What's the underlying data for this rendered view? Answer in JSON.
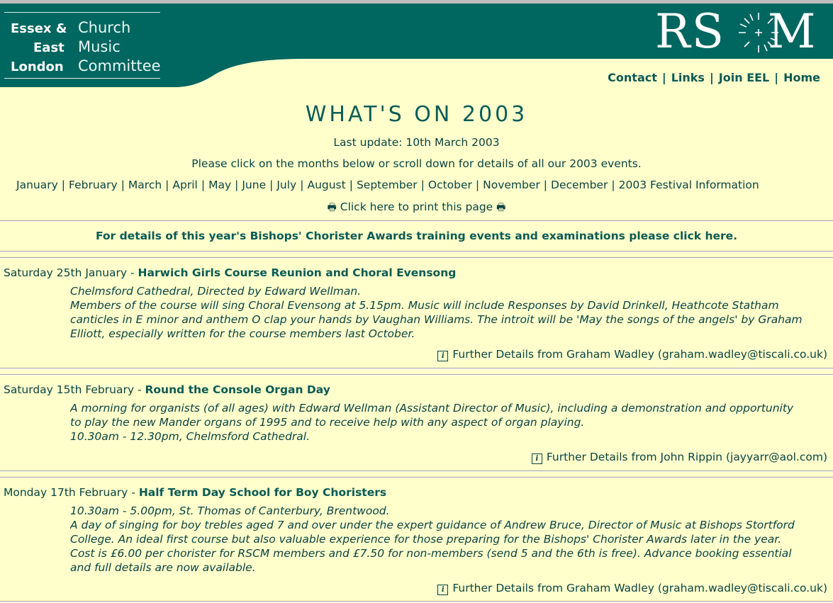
{
  "header": {
    "logo_left": [
      "Essex &",
      "East",
      "London"
    ],
    "logo_right": [
      "Church",
      "Music",
      "Committee"
    ],
    "rscm_left": "RS",
    "rscm_right": "M",
    "nav": [
      "Contact",
      "Links",
      "Join EEL",
      "Home"
    ]
  },
  "colors": {
    "banner": "#006660",
    "background": "#ffffcc",
    "text": "#0a4343",
    "link": "#0b5a55"
  },
  "page": {
    "title": "WHAT'S ON 2003",
    "last_update": "Last update: 10th March 2003",
    "instruction": "Please click on the months below or scroll down for details of all our 2003 events.",
    "months": [
      "January",
      "February",
      "March",
      "April",
      "May",
      "June",
      "July",
      "August",
      "September",
      "October",
      "November",
      "December",
      "2003 Festival Information"
    ],
    "print_link": "Click here to print this page",
    "print_icon": "printer-icon",
    "awards_link": "For details of this year's Bishops' Chorister Awards training events and examinations please click here."
  },
  "events": [
    {
      "date": "Saturday 25th January",
      "sep": " - ",
      "title": "Harwich Girls Course Reunion and Choral Evensong",
      "lines": [
        "Chelmsford Cathedral, Directed by Edward Wellman.",
        "Members of the course will sing Choral Evensong at 5.15pm. Music will include Responses by David Drinkell, Heathcote Statham",
        "canticles in E minor and anthem O clap your hands by Vaughan Williams. The introit will be 'May the songs of the angels' by Graham",
        "Elliott, especially written for the course members last October."
      ],
      "contact": "Further Details from Graham Wadley (graham.wadley@tiscali.co.uk)",
      "icon": "info-icon"
    },
    {
      "date": "Saturday 15th February",
      "sep": " - ",
      "title": "Round the Console Organ Day",
      "lines": [
        "A morning for organists (of all ages) with Edward Wellman (Assistant Director of Music), including a demonstration and opportunity",
        "to play the new Mander organs of 1995 and to receive help with any aspect of organ playing.",
        "10.30am - 12.30pm, Chelmsford Cathedral."
      ],
      "contact": "Further Details from John Rippin (jayyarr@aol.com)",
      "icon": "info-icon"
    },
    {
      "date": "Monday 17th February",
      "sep": " - ",
      "title": "Half Term Day School for Boy Choristers",
      "lines": [
        "10.30am - 5.00pm, St. Thomas of Canterbury, Brentwood.",
        "A day of singing for boy trebles aged 7 and over under the expert guidance of Andrew Bruce, Director of Music at Bishops Stortford",
        "College. An ideal first course but also valuable experience for those preparing for the Bishops' Chorister Awards later in the year.",
        "Cost is £6.00 per chorister for RSCM members and £7.50 for non-members (send 5 and the 6th is free). Advance booking essential",
        "and full details are now available."
      ],
      "contact": "Further Details from Graham Wadley (graham.wadley@tiscali.co.uk)",
      "icon": "info-icon"
    }
  ]
}
